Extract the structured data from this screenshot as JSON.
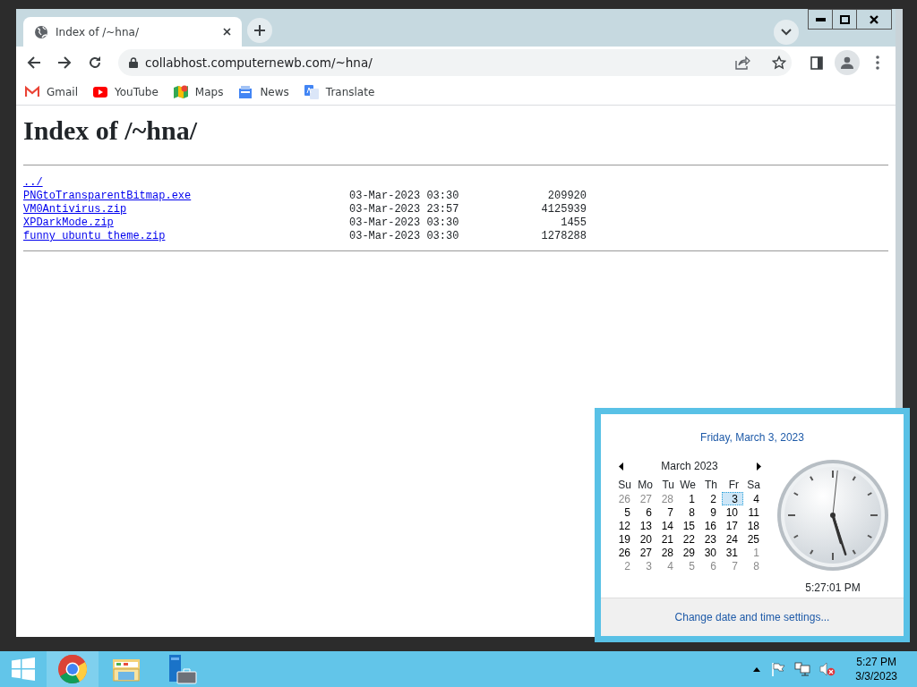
{
  "browser": {
    "tabs": [
      {
        "title": "Index of /~hna/",
        "selected": true
      }
    ],
    "url": "collabhost.computernewb.com/~hna/",
    "bookmarks": [
      {
        "kind": "mail",
        "label": "Gmail"
      },
      {
        "kind": "video",
        "label": "YouTube"
      },
      {
        "kind": "map",
        "label": "Maps"
      },
      {
        "kind": "news",
        "label": "News"
      },
      {
        "kind": "translate",
        "label": "Translate"
      }
    ]
  },
  "page": {
    "heading": "Index of /~hna/",
    "parent_link": "../",
    "entries": [
      {
        "name": "PNGtoTransparentBitmap.exe",
        "date": "03-Mar-2023 03:30",
        "size": "209920"
      },
      {
        "name": "VM0Antivirus.zip",
        "date": "03-Mar-2023 23:57",
        "size": "4125939"
      },
      {
        "name": "XPDarkMode.zip",
        "date": "03-Mar-2023 03:30",
        "size": "1455"
      },
      {
        "name": "funny_ubuntu_theme.zip",
        "date": "03-Mar-2023 03:30",
        "size": "1278288"
      }
    ]
  },
  "calendar_flyout": {
    "date_heading": "Friday, March 3, 2023",
    "month_label": "March 2023",
    "weekdays": [
      "Su",
      "Mo",
      "Tu",
      "We",
      "Th",
      "Fr",
      "Sa"
    ],
    "weeks": [
      [
        {
          "day": "26",
          "other_month": true,
          "selected": false
        },
        {
          "day": "27",
          "other_month": true,
          "selected": false
        },
        {
          "day": "28",
          "other_month": true,
          "selected": false
        },
        {
          "day": "1",
          "other_month": false,
          "selected": false
        },
        {
          "day": "2",
          "other_month": false,
          "selected": false
        },
        {
          "day": "3",
          "other_month": false,
          "selected": true
        },
        {
          "day": "4",
          "other_month": false,
          "selected": false
        }
      ],
      [
        {
          "day": "5",
          "other_month": false,
          "selected": false
        },
        {
          "day": "6",
          "other_month": false,
          "selected": false
        },
        {
          "day": "7",
          "other_month": false,
          "selected": false
        },
        {
          "day": "8",
          "other_month": false,
          "selected": false
        },
        {
          "day": "9",
          "other_month": false,
          "selected": false
        },
        {
          "day": "10",
          "other_month": false,
          "selected": false
        },
        {
          "day": "11",
          "other_month": false,
          "selected": false
        }
      ],
      [
        {
          "day": "12",
          "other_month": false,
          "selected": false
        },
        {
          "day": "13",
          "other_month": false,
          "selected": false
        },
        {
          "day": "14",
          "other_month": false,
          "selected": false
        },
        {
          "day": "15",
          "other_month": false,
          "selected": false
        },
        {
          "day": "16",
          "other_month": false,
          "selected": false
        },
        {
          "day": "17",
          "other_month": false,
          "selected": false
        },
        {
          "day": "18",
          "other_month": false,
          "selected": false
        }
      ],
      [
        {
          "day": "19",
          "other_month": false,
          "selected": false
        },
        {
          "day": "20",
          "other_month": false,
          "selected": false
        },
        {
          "day": "21",
          "other_month": false,
          "selected": false
        },
        {
          "day": "22",
          "other_month": false,
          "selected": false
        },
        {
          "day": "23",
          "other_month": false,
          "selected": false
        },
        {
          "day": "24",
          "other_month": false,
          "selected": false
        },
        {
          "day": "25",
          "other_month": false,
          "selected": false
        }
      ],
      [
        {
          "day": "26",
          "other_month": false,
          "selected": false
        },
        {
          "day": "27",
          "other_month": false,
          "selected": false
        },
        {
          "day": "28",
          "other_month": false,
          "selected": false
        },
        {
          "day": "29",
          "other_month": false,
          "selected": false
        },
        {
          "day": "30",
          "other_month": false,
          "selected": false
        },
        {
          "day": "31",
          "other_month": false,
          "selected": false
        },
        {
          "day": "1",
          "other_month": true,
          "selected": false
        }
      ],
      [
        {
          "day": "2",
          "other_month": true,
          "selected": false
        },
        {
          "day": "3",
          "other_month": true,
          "selected": false
        },
        {
          "day": "4",
          "other_month": true,
          "selected": false
        },
        {
          "day": "5",
          "other_month": true,
          "selected": false
        },
        {
          "day": "6",
          "other_month": true,
          "selected": false
        },
        {
          "day": "7",
          "other_month": true,
          "selected": false
        },
        {
          "day": "8",
          "other_month": true,
          "selected": false
        }
      ]
    ],
    "time": "5:27:01 PM",
    "settings_link": "Change date and time settings..."
  },
  "taskbar": {
    "time": "5:27 PM",
    "date": "3/3/2023"
  }
}
